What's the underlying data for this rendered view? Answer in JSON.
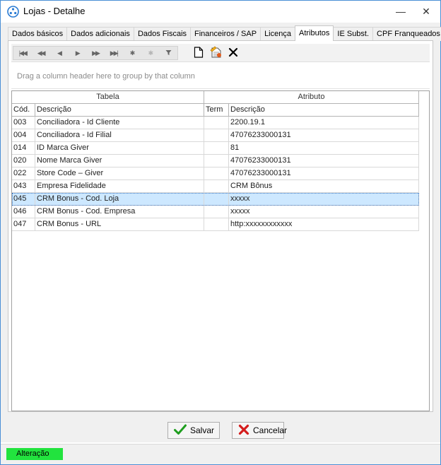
{
  "window": {
    "title": "Lojas - Detalhe",
    "minimize_glyph": "—",
    "close_glyph": "✕"
  },
  "tabs": [
    {
      "label": "Dados básicos"
    },
    {
      "label": "Dados adicionais"
    },
    {
      "label": "Dados Fiscais"
    },
    {
      "label": "Financeiros / SAP"
    },
    {
      "label": "Licença"
    },
    {
      "label": "Atributos",
      "active": true
    },
    {
      "label": "IE Subst."
    },
    {
      "label": "CPF Franqueados"
    }
  ],
  "toolbar": {
    "nav_icons": [
      "first-icon",
      "prev-page-icon",
      "prev-icon",
      "next-icon",
      "next-page-icon",
      "last-icon",
      "insert-icon",
      "delete-record-icon",
      "filter-icon"
    ],
    "action_icons": [
      "new-document-icon",
      "edit-document-icon",
      "delete-icon"
    ]
  },
  "group_panel": {
    "hint": "Drag a column header here to group by that column"
  },
  "grid": {
    "bands": {
      "tabela": "Tabela",
      "atributo": "Atributo"
    },
    "columns": {
      "cod": "Cód.",
      "descricao": "Descrição",
      "term": "Term",
      "atributo_descricao": "Descrição"
    },
    "rows": [
      {
        "cod": "003",
        "descricao": "Conciliadora - Id Cliente",
        "term": "",
        "valor": "2200.19.1"
      },
      {
        "cod": "004",
        "descricao": "Conciliadora - Id Filial",
        "term": "",
        "valor": "47076233000131"
      },
      {
        "cod": "014",
        "descricao": "ID Marca Giver",
        "term": "",
        "valor": "81"
      },
      {
        "cod": "020",
        "descricao": "Nome Marca Giver",
        "term": "",
        "valor": "47076233000131"
      },
      {
        "cod": "022",
        "descricao": "Store Code – Giver",
        "term": "",
        "valor": "47076233000131"
      },
      {
        "cod": "043",
        "descricao": "Empresa Fidelidade",
        "term": "",
        "valor": "CRM Bônus"
      },
      {
        "cod": "045",
        "descricao": "CRM Bonus - Cod. Loja",
        "term": "",
        "valor": "xxxxx",
        "selected": true
      },
      {
        "cod": "046",
        "descricao": "CRM Bonus - Cod. Empresa",
        "term": "",
        "valor": "xxxxx"
      },
      {
        "cod": "047",
        "descricao": "CRM Bonus - URL",
        "term": "",
        "valor": "http:xxxxxxxxxxxx"
      }
    ]
  },
  "buttons": {
    "save_label": "Salvar",
    "cancel_label": "Cancelar"
  },
  "status": {
    "text": "Alteração",
    "color": "#22e33e"
  },
  "colors": {
    "selection": "#cde8ff",
    "window_border": "#4a8fd6"
  }
}
